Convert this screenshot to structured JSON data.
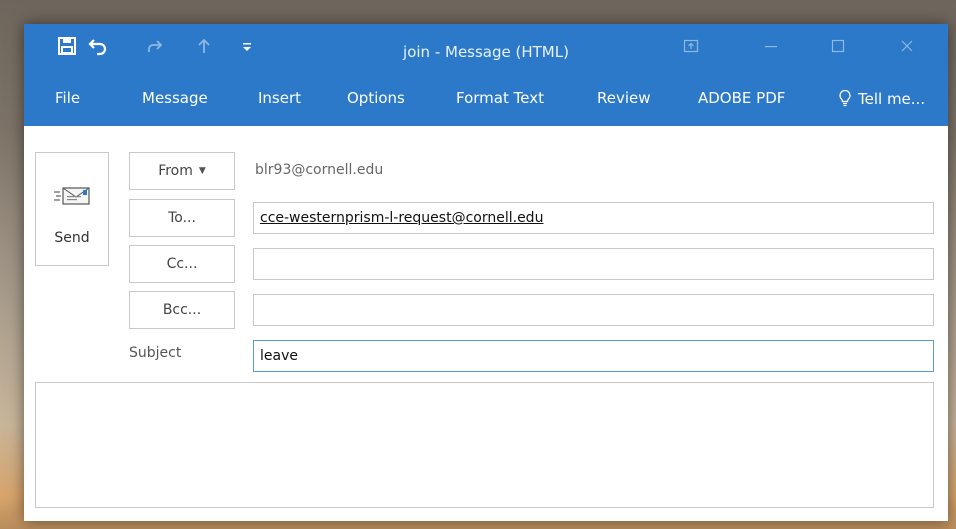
{
  "window": {
    "title": "join - Message (HTML)"
  },
  "ribbon": {
    "tabs": [
      "File",
      "Message",
      "Insert",
      "Options",
      "Format Text",
      "Review",
      "ADOBE PDF"
    ],
    "tell_me": "Tell me..."
  },
  "compose": {
    "send_label": "Send",
    "from_label": "From",
    "from_value": "blr93@cornell.edu",
    "to_label": "To...",
    "to_value": "cce-westernprism-l-request@cornell.edu",
    "cc_label": "Cc...",
    "cc_value": "",
    "bcc_label": "Bcc...",
    "bcc_value": "",
    "subject_label": "Subject",
    "subject_value": "leave",
    "body_value": ""
  },
  "colors": {
    "accent": "#2b79c8",
    "focus_border": "#5b9bd5"
  },
  "icons": {
    "save": "save-icon",
    "undo": "undo-icon",
    "redo": "redo-icon",
    "up": "up-arrow-icon",
    "customize": "customize-quick-access-icon",
    "ribbon_display": "ribbon-display-options-icon",
    "minimize": "minimize-icon",
    "maximize": "maximize-icon",
    "close": "close-icon",
    "tell_me": "lightbulb-icon",
    "send": "send-envelope-icon"
  }
}
